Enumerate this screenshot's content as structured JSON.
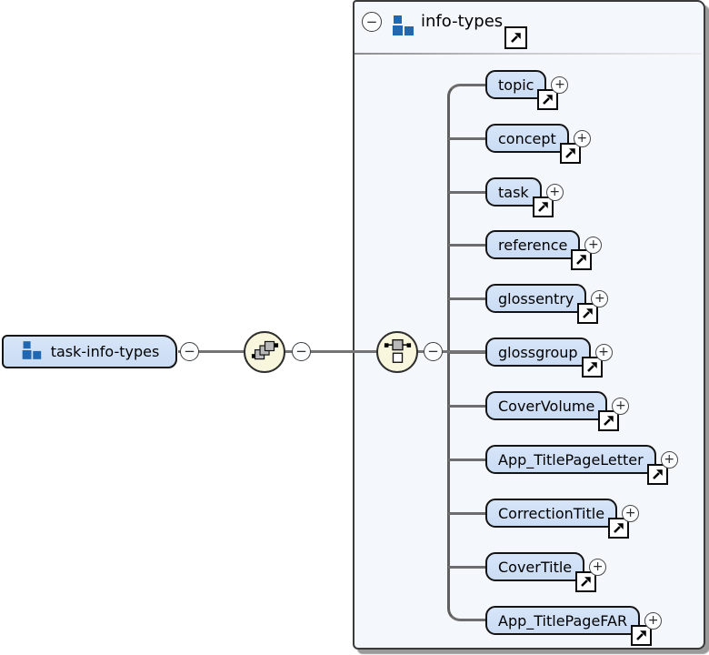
{
  "root_element": {
    "label": "task-info-types",
    "icon": "element-icon"
  },
  "connectors": {
    "compositors": [
      {
        "name": "sequence-compositor"
      },
      {
        "name": "choice-compositor"
      }
    ]
  },
  "glyphs": {
    "minus": "−",
    "plus": "+"
  },
  "panel": {
    "header": {
      "label": "info-types",
      "icon": "element-icon"
    },
    "children": [
      {
        "label": "topic"
      },
      {
        "label": "concept"
      },
      {
        "label": "task"
      },
      {
        "label": "reference"
      },
      {
        "label": "glossentry"
      },
      {
        "label": "glossgroup"
      },
      {
        "label": "CoverVolume"
      },
      {
        "label": "App_TitlePageLetter"
      },
      {
        "label": "CorrectionTitle"
      },
      {
        "label": "CoverTitle"
      },
      {
        "label": "App_TitlePageFAR"
      }
    ]
  },
  "colors": {
    "element_fill": "#cfe1f6",
    "element_border": "#141414",
    "compositor_fill": "#f8f7dd",
    "panel_background": "#f4f7fb",
    "connector_gray": "#747474",
    "icon_blue": "#2068b2"
  }
}
